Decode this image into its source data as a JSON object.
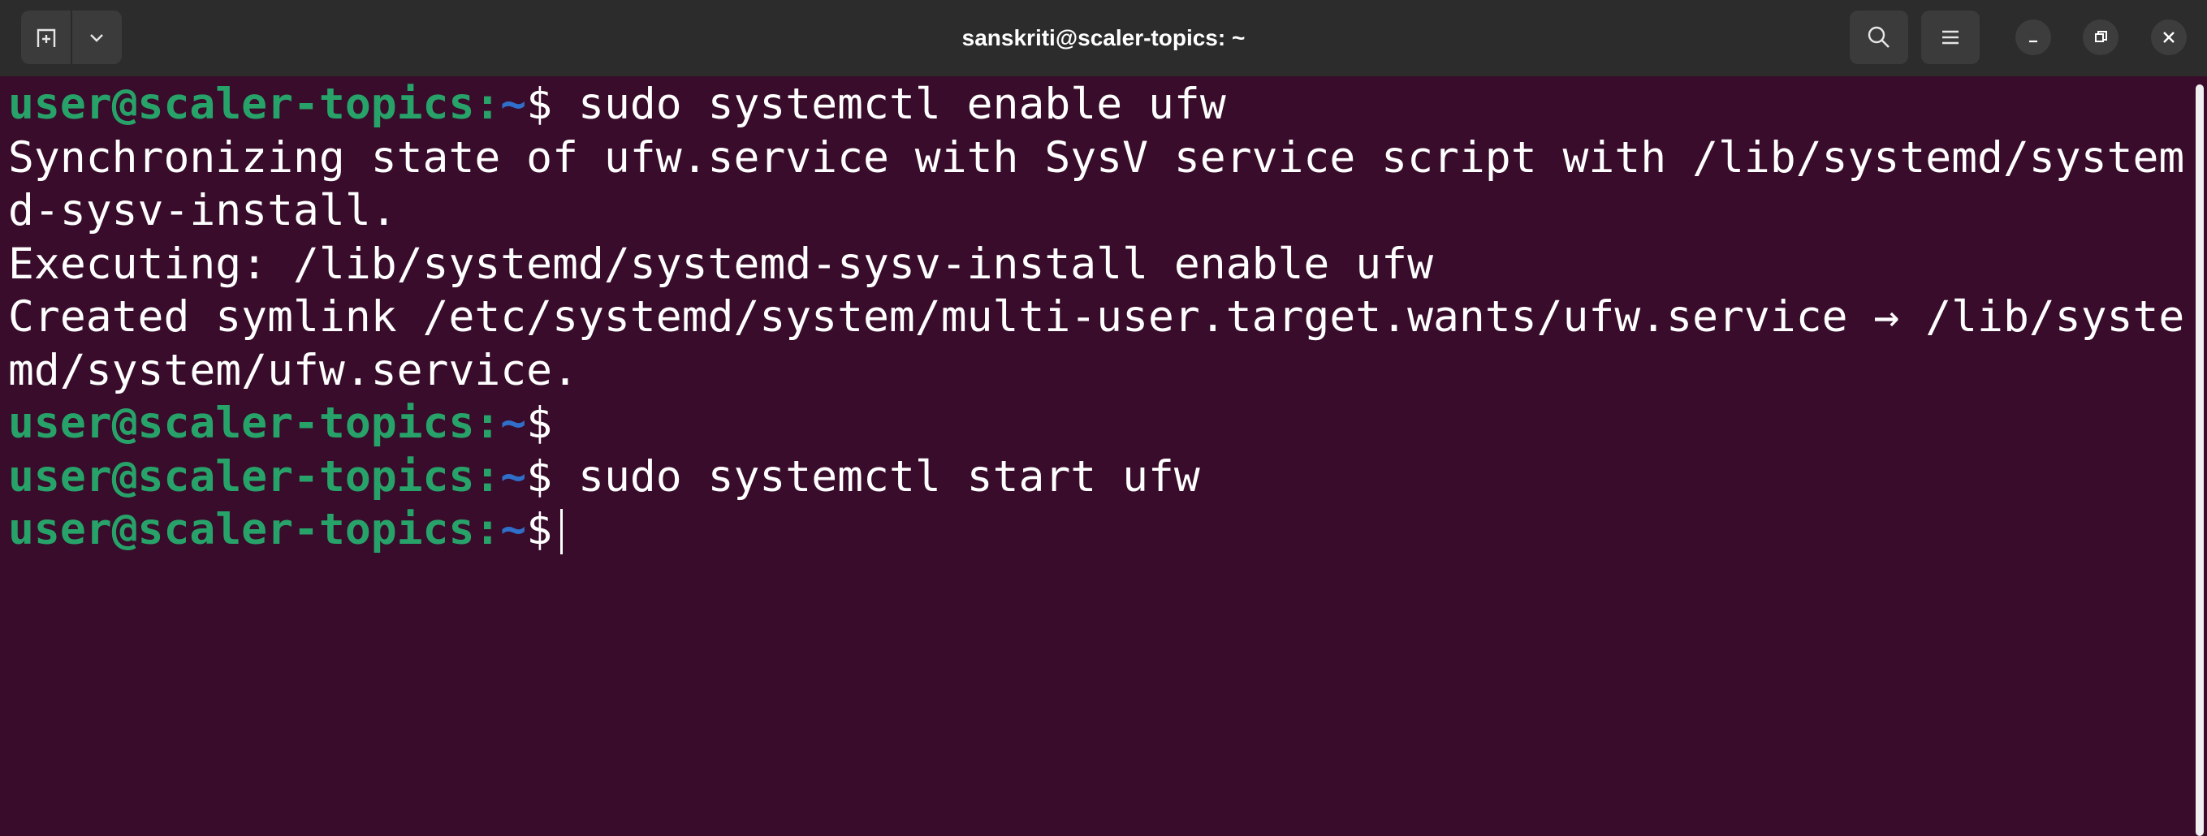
{
  "window": {
    "title": "sanskriti@scaler-topics: ~"
  },
  "headerbar": {
    "new_tab_icon": "new-tab-icon",
    "menu_dropdown_icon": "chevron-down-icon",
    "search_icon": "search-icon",
    "hamburger_icon": "hamburger-menu-icon",
    "minimize_icon": "minimize-icon",
    "restore_icon": "restore-icon",
    "close_icon": "close-icon"
  },
  "colors": {
    "background": "#380c2a",
    "header": "#2c2c2c",
    "prompt_user_host": "#27a36a",
    "prompt_path": "#2f6fc9",
    "text": "#ffffff"
  },
  "terminal": {
    "lines": [
      {
        "type": "prompt",
        "user_host": "user@scaler-topics",
        "sep": ":",
        "path": "~",
        "symbol": "$",
        "command": " sudo systemctl enable ufw"
      },
      {
        "type": "output",
        "text": "Synchronizing state of ufw.service with SysV service script with /lib/systemd/system"
      },
      {
        "type": "output",
        "text": "d-sysv-install."
      },
      {
        "type": "output",
        "text": "Executing: /lib/systemd/systemd-sysv-install enable ufw"
      },
      {
        "type": "output",
        "text": "Created symlink /etc/systemd/system/multi-user.target.wants/ufw.service → /lib/syste"
      },
      {
        "type": "output",
        "text": "md/system/ufw.service."
      },
      {
        "type": "prompt",
        "user_host": "user@scaler-topics",
        "sep": ":",
        "path": "~",
        "symbol": "$",
        "command": ""
      },
      {
        "type": "prompt",
        "user_host": "user@scaler-topics",
        "sep": ":",
        "path": "~",
        "symbol": "$",
        "command": " sudo systemctl start ufw"
      },
      {
        "type": "prompt",
        "user_host": "user@scaler-topics",
        "sep": ":",
        "path": "~",
        "symbol": "$",
        "command": " ",
        "cursor": true
      }
    ]
  }
}
